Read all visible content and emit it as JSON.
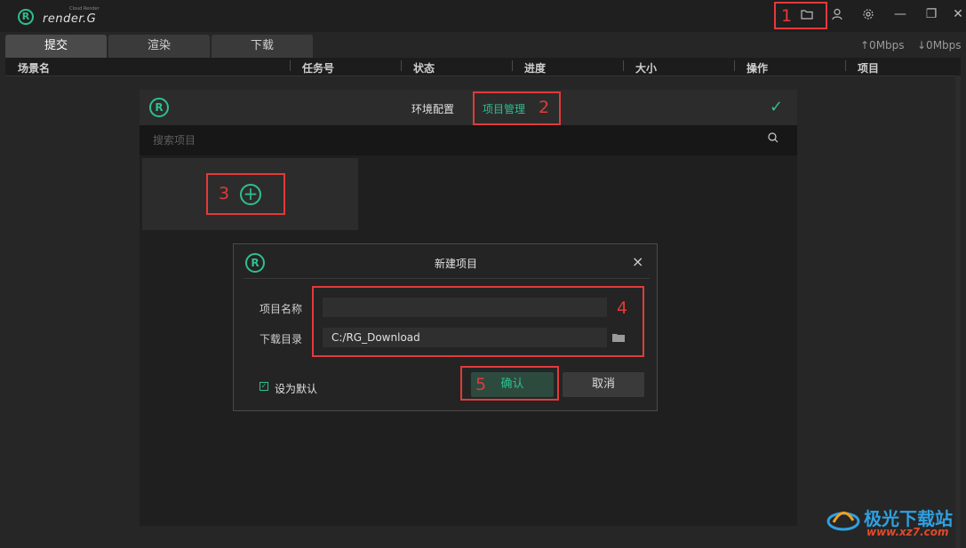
{
  "app": {
    "logo_text": "render.G",
    "logo_subtext": "Cloud Render",
    "logo_mark": "R"
  },
  "window_controls": {
    "folder_icon": "folder-icon",
    "user_icon": "user-icon",
    "settings_icon": "gear-icon",
    "minimize": "—",
    "restore": "❐",
    "close": "✕"
  },
  "tabs": [
    {
      "label": "提交",
      "active": true
    },
    {
      "label": "渲染",
      "active": false
    },
    {
      "label": "下载",
      "active": false
    }
  ],
  "speed": {
    "upload": "↑0Mbps",
    "download": "↓0Mbps"
  },
  "table": {
    "columns": [
      "场景名",
      "任务号",
      "状态",
      "进度",
      "大小",
      "操作",
      "项目"
    ]
  },
  "panel": {
    "tab_env": "环境配置",
    "tab_project": "项目管理",
    "search_placeholder": "搜索项目",
    "add_symbol": "+"
  },
  "dialog": {
    "title": "新建项目",
    "close": "×",
    "name_label": "项目名称",
    "name_value": "",
    "dir_label": "下载目录",
    "dir_value": "C:/RG_Download",
    "set_default_label": "设为默认",
    "set_default_checked": true,
    "confirm_label": "确认",
    "cancel_label": "取消"
  },
  "annotations": [
    "1",
    "2",
    "3",
    "4",
    "5"
  ],
  "watermark": {
    "text": "极光下载站",
    "url": "www.xz7.com"
  },
  "colors": {
    "accent": "#2fbf8f",
    "annotation": "#e23a3a",
    "background": "#262626"
  }
}
